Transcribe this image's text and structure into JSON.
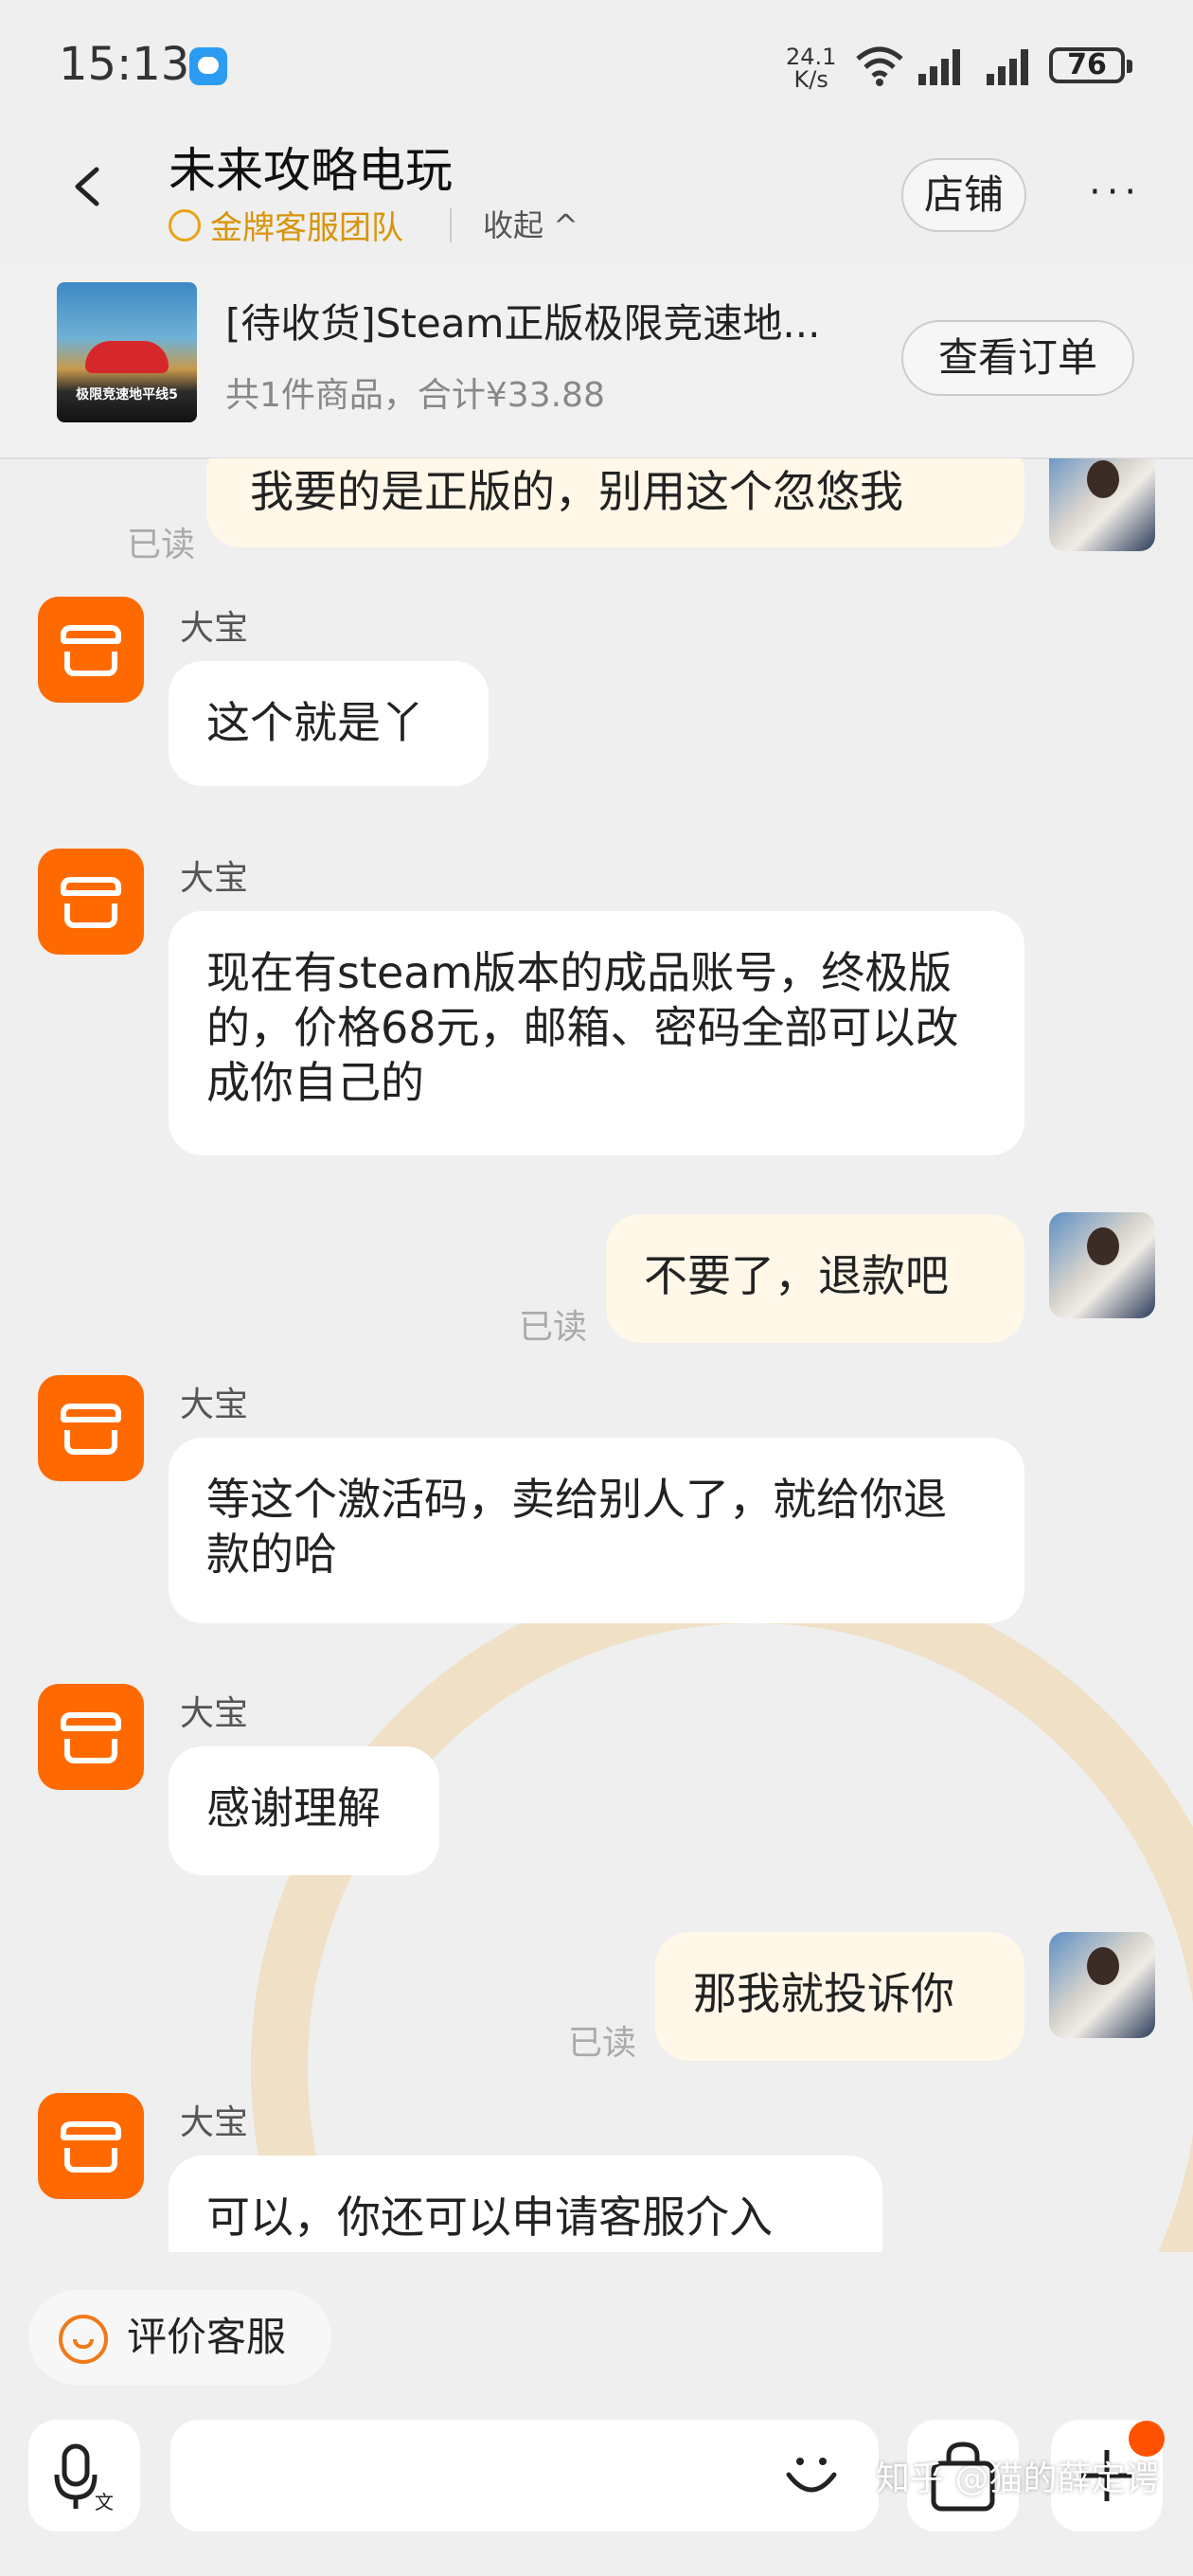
{
  "status_bar": {
    "time": "15:13",
    "net_speed": "24.1",
    "net_unit": "K/s",
    "wifi_label": "6",
    "battery": "76"
  },
  "header": {
    "shop_name": "未来攻略电玩",
    "team": "金牌客服团队",
    "collapse": "收起 ^",
    "store_button": "店铺",
    "more": "···"
  },
  "order": {
    "title": "[待收货]Steam正版极限竞速地...",
    "summary": "共1件商品，合计¥33.88",
    "view_button": "查看订单",
    "thumb_text": "极限竞速地平线5"
  },
  "messages": [
    {
      "from": "me",
      "text": "我要的是正版的，别用这个忽悠我",
      "status": "已读"
    },
    {
      "from": "shop",
      "sender": "大宝",
      "text": "这个就是丫"
    },
    {
      "from": "shop",
      "sender": "大宝",
      "text": "现在有steam版本的成品账号，终极版的，价格68元，邮箱、密码全部可以改成你自己的"
    },
    {
      "from": "me",
      "text": "不要了，退款吧",
      "status": "已读"
    },
    {
      "from": "shop",
      "sender": "大宝",
      "text": "等这个激活码，卖给别人了，就给你退款的哈"
    },
    {
      "from": "shop",
      "sender": "大宝",
      "text": "感谢理解"
    },
    {
      "from": "me",
      "text": "那我就投诉你",
      "status": "已读"
    },
    {
      "from": "shop",
      "sender": "大宝",
      "text": "可以，你还可以申请客服介入"
    }
  ],
  "bottom": {
    "rate_label": "评价客服",
    "watermark": "知乎 @猫的薛定谔"
  },
  "colors": {
    "accent": "#ff6a00",
    "gold": "#d8940a",
    "my_bubble": "#fff7e8"
  }
}
